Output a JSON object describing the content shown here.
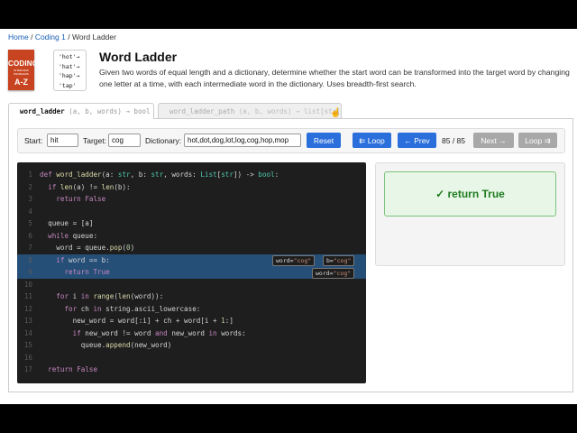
{
  "breadcrumb": {
    "home": "Home",
    "sep": "/",
    "coding": "Coding 1",
    "current": "Word Ladder"
  },
  "book": {
    "line1": "CODING",
    "line2": "INTERVIEW PROBLEMS",
    "line3": "A-Z"
  },
  "card": {
    "lines": [
      "'hot'→",
      "'hat'→",
      "'hap'→",
      "'tap'"
    ]
  },
  "header": {
    "title": "Word Ladder",
    "description": "Given two words of equal length and a dictionary, determine whether the start word can be transformed into the target word by changing one letter at a time, with each intermediate word in the dictionary. Uses breadth-first search."
  },
  "tabs": [
    {
      "name": "word_ladder",
      "sig": "(a, b, words) → bool"
    },
    {
      "name": "word_ladder_path",
      "sig": "(a, b, words) → list[str]"
    }
  ],
  "controls": {
    "start_label": "Start:",
    "start_value": "hit",
    "target_label": "Target:",
    "target_value": "cog",
    "dict_label": "Dictionary:",
    "dict_value": "hot,dot,dog,lot,log,cog,hop,mop",
    "reset": "Reset",
    "loop_btn": "⇇ Loop",
    "prev": "← Prev",
    "step": "85 / 85",
    "next": "Next →",
    "loop_end": "Loop ⇉"
  },
  "code": {
    "line_numbers": [
      "1",
      "2",
      "3",
      "4",
      "5",
      "6",
      "7",
      "8",
      "9",
      "10",
      "11",
      "12",
      "13",
      "14",
      "15",
      "16",
      "17"
    ],
    "highlight_lines": [
      8,
      9
    ],
    "badges": {
      "word1": "word",
      "val1": "\"cog\"",
      "b": "b",
      "val2": "\"cog\"",
      "word2": "word",
      "val3": "\"cog\""
    }
  },
  "result": {
    "text": "✓ return True"
  },
  "colors": {
    "accent": "#2a6fdb",
    "success": "#1e7b1e",
    "highlight": "#264f78",
    "code_bg": "#1e1e1e"
  }
}
